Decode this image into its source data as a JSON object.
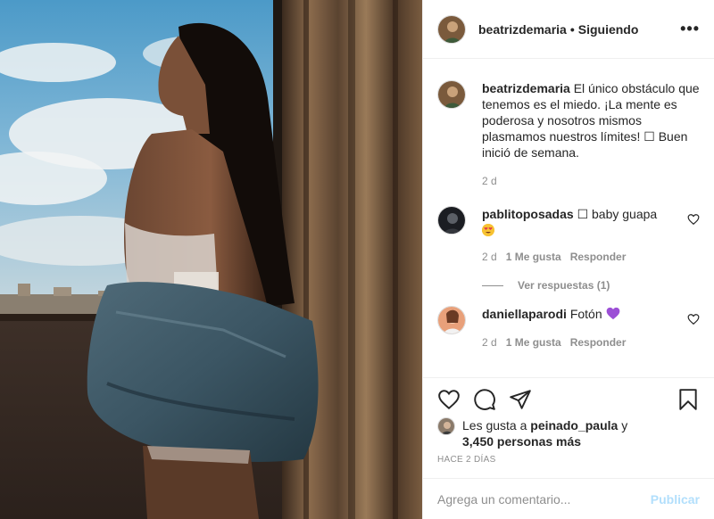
{
  "post": {
    "author": "beatrizdemaria",
    "follow_separator": "•",
    "follow_status": "Siguiendo",
    "more_label": "•••",
    "caption": {
      "username": "beatrizdemaria",
      "text": "El único obstáculo que tenemos es el miedo. ¡La mente es poderosa y nosotros mismos plasmamos nuestros límites! ☐ Buen inició de semana.",
      "time": "2 d"
    },
    "comments": [
      {
        "username": "pablitoposadas",
        "text": "☐ baby guapa",
        "emoji": "heart-eyes-emoji",
        "time": "2 d",
        "likes": "1 Me gusta",
        "reply": "Responder",
        "view_replies": "Ver respuestas (1)"
      },
      {
        "username": "daniellaparodi",
        "text": "Fotón",
        "emoji": "purple-heart-emoji",
        "time": "2 d",
        "likes": "1 Me gusta",
        "reply": "Responder"
      }
    ],
    "likes": {
      "prefix": "Les gusta a",
      "user": "peinado_paula",
      "joiner": "y",
      "others": "3,450 personas más"
    },
    "date": "HACE 2 DÍAS",
    "add_comment": {
      "placeholder": "Agrega un comentario...",
      "publish": "Publicar"
    },
    "icons": [
      "heart-icon",
      "comment-icon",
      "share-icon",
      "bookmark-icon",
      "like-heart-small-icon",
      "more-options-icon"
    ],
    "colors": {
      "publish_disabled": "#b2dffc",
      "text": "#262626",
      "muted": "#8e8e8e",
      "border": "#efefef"
    }
  }
}
